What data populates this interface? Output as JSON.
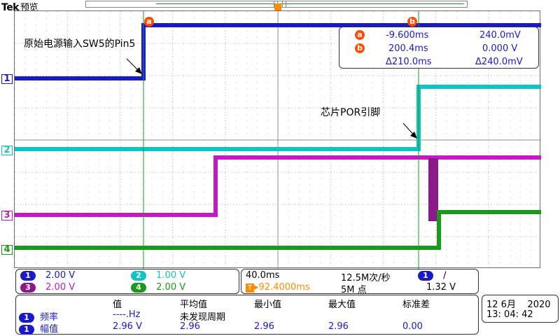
{
  "header": {
    "brand": "Tek",
    "mode": "预览"
  },
  "annotations": {
    "input_label": "原始电源输入SW5的Pin5",
    "por_label": "芯片POR引脚"
  },
  "cursors": {
    "a_tag": "a",
    "b_tag": "b",
    "a_time": "-9.600ms",
    "a_volt": "240.0mV",
    "b_time": "200.4ms",
    "b_volt": "0.000 V",
    "delta_time": "Δ210.0ms",
    "delta_volt": "Δ240.0mV"
  },
  "channel_markers": [
    "1",
    "2",
    "3",
    "4"
  ],
  "channels": [
    {
      "num": "1",
      "scale": "2.00 V",
      "color": "#1a1ac8"
    },
    {
      "num": "2",
      "scale": "1.00 V",
      "color": "#11c4c4"
    },
    {
      "num": "3",
      "scale": "2.00 V",
      "color": "#c41ac4"
    },
    {
      "num": "4",
      "scale": "2.00 V",
      "color": "#1a9a1a"
    }
  ],
  "timebase": {
    "scale": "40.0ms",
    "sample_rate": "12.5M次/秒",
    "trigger_pos": "▸92.4000ms",
    "record_length": "5M 点",
    "trig_channel": "1",
    "trig_slope": "∕",
    "trig_level": "1.32 V"
  },
  "measurements": {
    "headers": [
      "值",
      "平均值",
      "最小值",
      "最大值",
      "标准差"
    ],
    "rows": [
      {
        "ch": "1",
        "name": "频率",
        "value": "----.Hz",
        "mean": "未发现周期",
        "min": "",
        "max": "",
        "std": ""
      },
      {
        "ch": "1",
        "name": "幅值",
        "value": "2.96 V",
        "mean": "2.96",
        "min": "2.96",
        "max": "2.96",
        "std": "0.00"
      }
    ]
  },
  "datetime": {
    "date": "12 6月    2020",
    "time": "13: 04: 42"
  },
  "colors": {
    "ch1": "#1a1ac8",
    "ch2": "#11c4c4",
    "ch3": "#c41ac4",
    "ch4": "#1a9a1a",
    "cursor": "#1a9a1a",
    "cursor_tag": "#ff4b00"
  }
}
